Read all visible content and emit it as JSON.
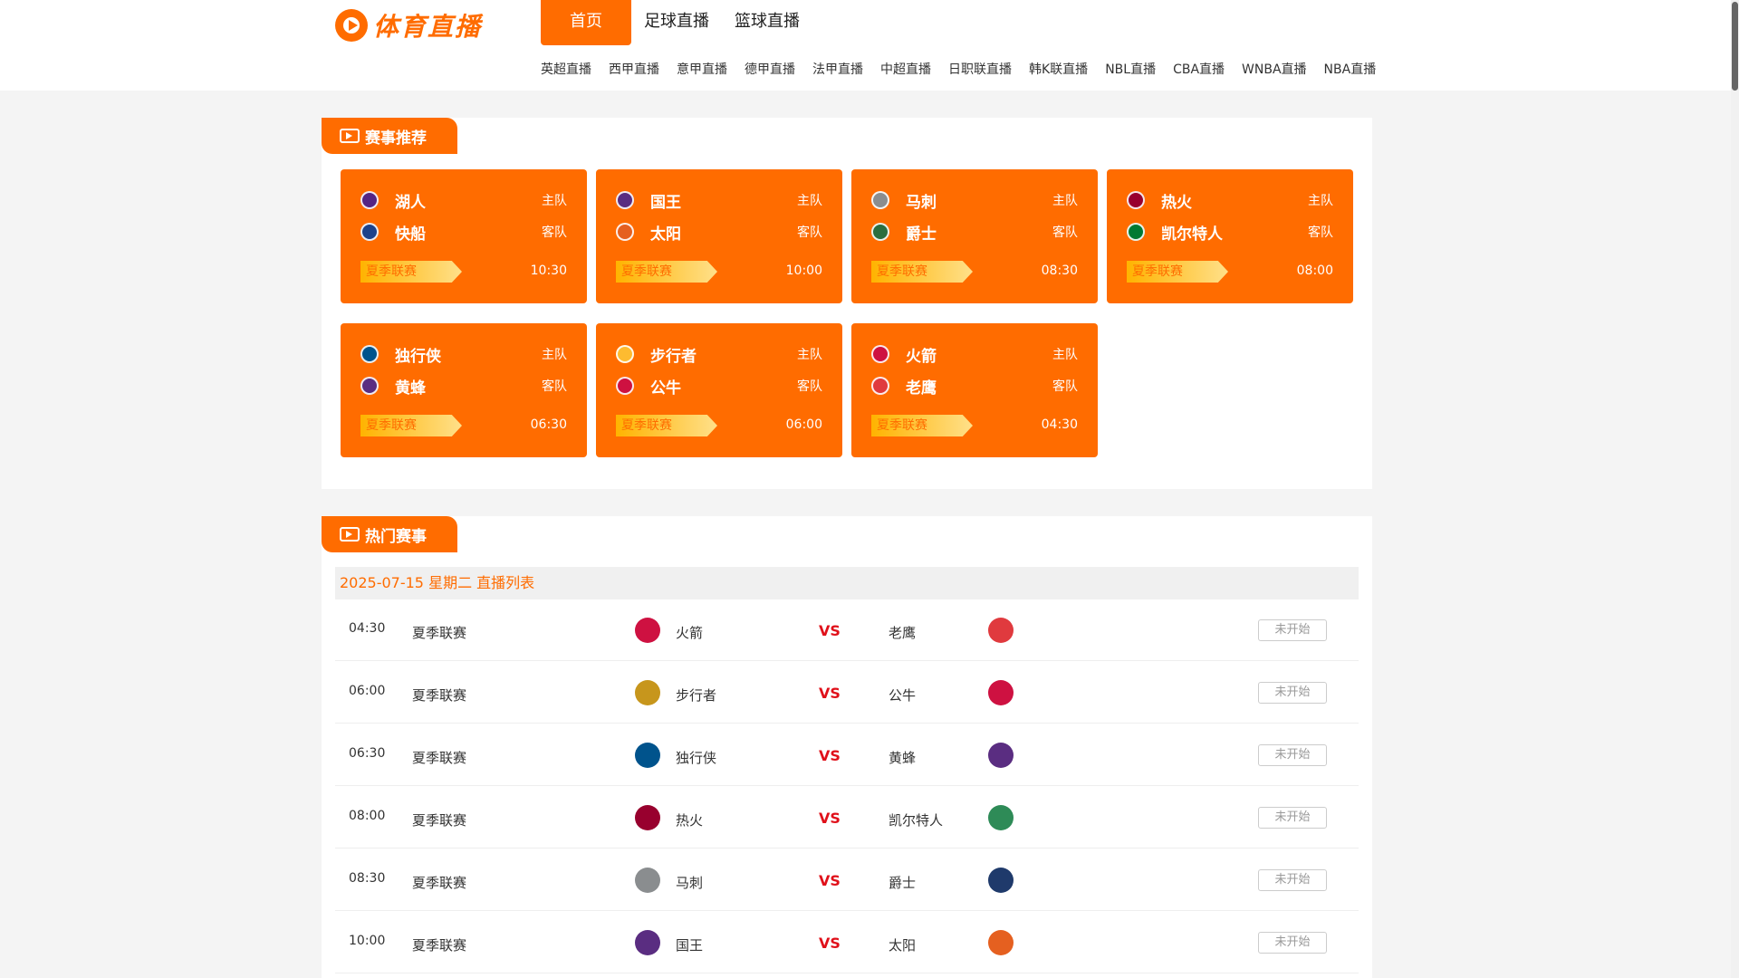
{
  "header": {
    "logo_text": "体育直播",
    "nav": [
      "首页",
      "足球直播",
      "篮球直播"
    ],
    "subnav": [
      "英超直播",
      "西甲直播",
      "意甲直播",
      "德甲直播",
      "法甲直播",
      "中超直播",
      "日职联直播",
      "韩K联直播",
      "NBL直播",
      "CBA直播",
      "WNBA直播",
      "NBA直播"
    ]
  },
  "recommend": {
    "title": "赛事推荐",
    "home_label": "主队",
    "away_label": "客队",
    "cards": [
      {
        "home": "湖人",
        "away": "快船",
        "league": "夏季联赛",
        "time": "10:30",
        "home_color": "#552583",
        "away_color": "#1d428a"
      },
      {
        "home": "国王",
        "away": "太阳",
        "league": "夏季联赛",
        "time": "10:00",
        "home_color": "#5a2d81",
        "away_color": "#e56020"
      },
      {
        "home": "马刺",
        "away": "爵士",
        "league": "夏季联赛",
        "time": "08:30",
        "home_color": "#8a8d8f",
        "away_color": "#2c6e3f"
      },
      {
        "home": "热火",
        "away": "凯尔特人",
        "league": "夏季联赛",
        "time": "08:00",
        "home_color": "#98002e",
        "away_color": "#007a33"
      },
      {
        "home": "独行侠",
        "away": "黄蜂",
        "league": "夏季联赛",
        "time": "06:30",
        "home_color": "#00538c",
        "away_color": "#5a2d81"
      },
      {
        "home": "步行者",
        "away": "公牛",
        "league": "夏季联赛",
        "time": "06:00",
        "home_color": "#fdbb30",
        "away_color": "#ce1141"
      },
      {
        "home": "火箭",
        "away": "老鹰",
        "league": "夏季联赛",
        "time": "04:30",
        "home_color": "#ce1141",
        "away_color": "#e03a3e"
      }
    ]
  },
  "hot": {
    "title": "热门赛事",
    "date_line": "2025-07-15 星期二 直播列表",
    "vs_label": "VS",
    "status_label": "未开始",
    "matches": [
      {
        "time": "04:30",
        "league": "夏季联赛",
        "home": "火箭",
        "away": "老鹰",
        "home_color": "#ce1141",
        "away_color": "#e03a3e"
      },
      {
        "time": "06:00",
        "league": "夏季联赛",
        "home": "步行者",
        "away": "公牛",
        "home_color": "#c7961c",
        "away_color": "#ce1141"
      },
      {
        "time": "06:30",
        "league": "夏季联赛",
        "home": "独行侠",
        "away": "黄蜂",
        "home_color": "#00538c",
        "away_color": "#5a2d81"
      },
      {
        "time": "08:00",
        "league": "夏季联赛",
        "home": "热火",
        "away": "凯尔特人",
        "home_color": "#98002e",
        "away_color": "#2e8b57"
      },
      {
        "time": "08:30",
        "league": "夏季联赛",
        "home": "马刺",
        "away": "爵士",
        "home_color": "#8a8d8f",
        "away_color": "#1f3a6b"
      },
      {
        "time": "10:00",
        "league": "夏季联赛",
        "home": "国王",
        "away": "太阳",
        "home_color": "#5a2d81",
        "away_color": "#e56020"
      }
    ]
  },
  "colors": {
    "accent": "#ff6c00",
    "vs": "#e0101a"
  }
}
